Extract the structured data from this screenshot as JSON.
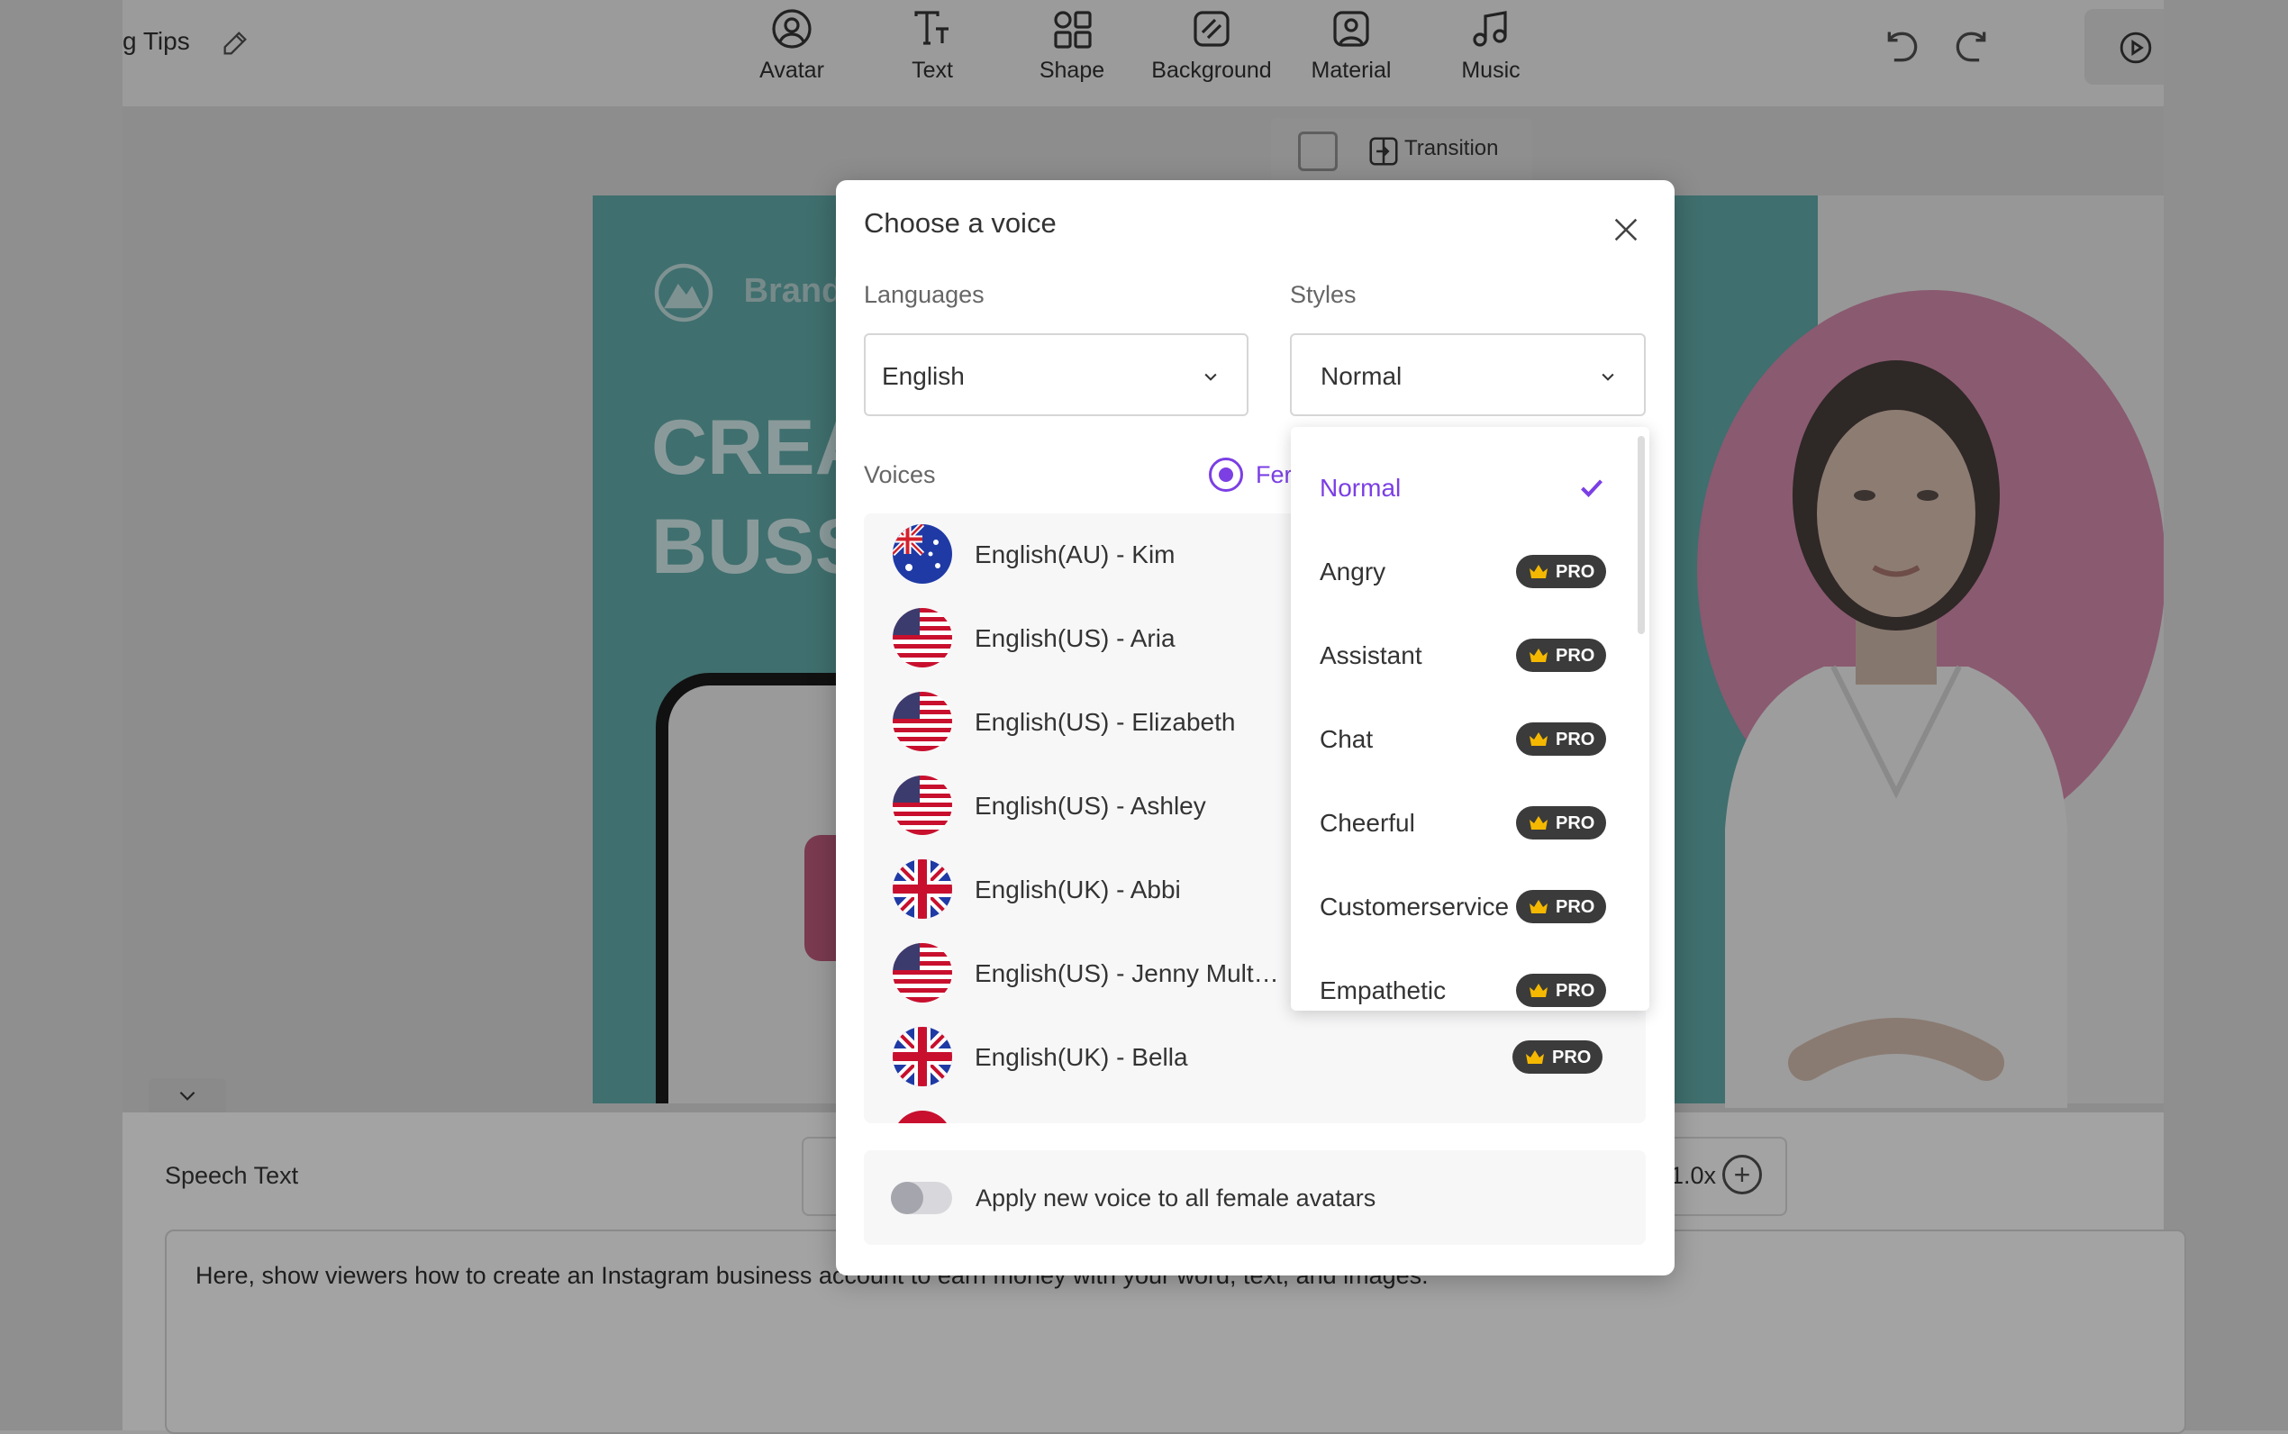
{
  "toolbar": {
    "tips_label": "g Tips",
    "tools": [
      {
        "label": "Avatar",
        "icon": "avatar-icon"
      },
      {
        "label": "Text",
        "icon": "text-icon"
      },
      {
        "label": "Shape",
        "icon": "shape-icon"
      },
      {
        "label": "Background",
        "icon": "background-icon"
      },
      {
        "label": "Material",
        "icon": "material-icon"
      },
      {
        "label": "Music",
        "icon": "music-icon"
      }
    ]
  },
  "canvas": {
    "transition_label": "Transition",
    "brand_text": "Brand",
    "slide_title_line1": "CREA",
    "slide_title_line2": "BUSS"
  },
  "bottom": {
    "speech_text_label": "Speech Text",
    "speed_value": "1.0x",
    "speech_text": "Here, show viewers how to create an Instagram business account to earn money with your word, text, and images."
  },
  "modal": {
    "title": "Choose a voice",
    "languages_label": "Languages",
    "language_value": "English",
    "styles_label": "Styles",
    "style_value": "Normal",
    "voices_label": "Voices",
    "gender_radio_label": "Fer",
    "voices": [
      {
        "name": "English(AU) - Kim",
        "flag": "au",
        "pro": false
      },
      {
        "name": "English(US) - Aria",
        "flag": "us",
        "pro": false
      },
      {
        "name": "English(US) - Elizabeth",
        "flag": "us",
        "pro": false
      },
      {
        "name": "English(US) - Ashley",
        "flag": "us",
        "pro": false
      },
      {
        "name": "English(UK) - Abbi",
        "flag": "uk",
        "pro": false
      },
      {
        "name": "English(US) - Jenny Multilin...",
        "flag": "us",
        "pro": false
      },
      {
        "name": "English(UK) - Bella",
        "flag": "uk",
        "pro": true
      }
    ],
    "apply_label": "Apply new voice to all female avatars",
    "pro_label": "PRO"
  },
  "styles_dropdown": {
    "options": [
      {
        "label": "Normal",
        "pro": false,
        "selected": true
      },
      {
        "label": "Angry",
        "pro": true,
        "selected": false
      },
      {
        "label": "Assistant",
        "pro": true,
        "selected": false
      },
      {
        "label": "Chat",
        "pro": true,
        "selected": false
      },
      {
        "label": "Cheerful",
        "pro": true,
        "selected": false
      },
      {
        "label": "Customerservice",
        "pro": true,
        "selected": false
      },
      {
        "label": "Empathetic",
        "pro": true,
        "selected": false
      }
    ]
  },
  "colors": {
    "accent": "#7b3fe4",
    "pro_badge": "#3b3b3b",
    "crown": "#f5b800"
  }
}
